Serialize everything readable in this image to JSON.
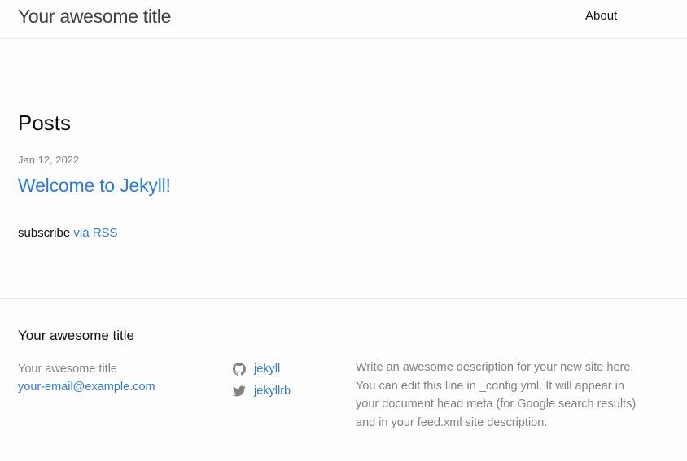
{
  "header": {
    "site_title": "Your awesome title",
    "nav": [
      {
        "label": "About"
      }
    ]
  },
  "main": {
    "heading": "Posts",
    "posts": [
      {
        "date": "Jan 12, 2022",
        "title": "Welcome to Jekyll!"
      }
    ],
    "rss": {
      "prefix": "subscribe",
      "link_label": "via RSS"
    }
  },
  "footer": {
    "heading": "Your awesome title",
    "contact": {
      "name": "Your awesome title",
      "email": "your-email@example.com"
    },
    "social": [
      {
        "icon": "github-icon",
        "label": "jekyll"
      },
      {
        "icon": "twitter-icon",
        "label": "jekyllrb"
      }
    ],
    "description": "Write an awesome description for your new site here. You can edit this line in _config.yml. It will appear in your document head meta (for Google search results) and in your feed.xml site description."
  },
  "colors": {
    "link": "#2a7ae2",
    "muted": "#828282",
    "text": "#111111",
    "border": "#e8e8e8",
    "background": "#fdfdfd"
  }
}
